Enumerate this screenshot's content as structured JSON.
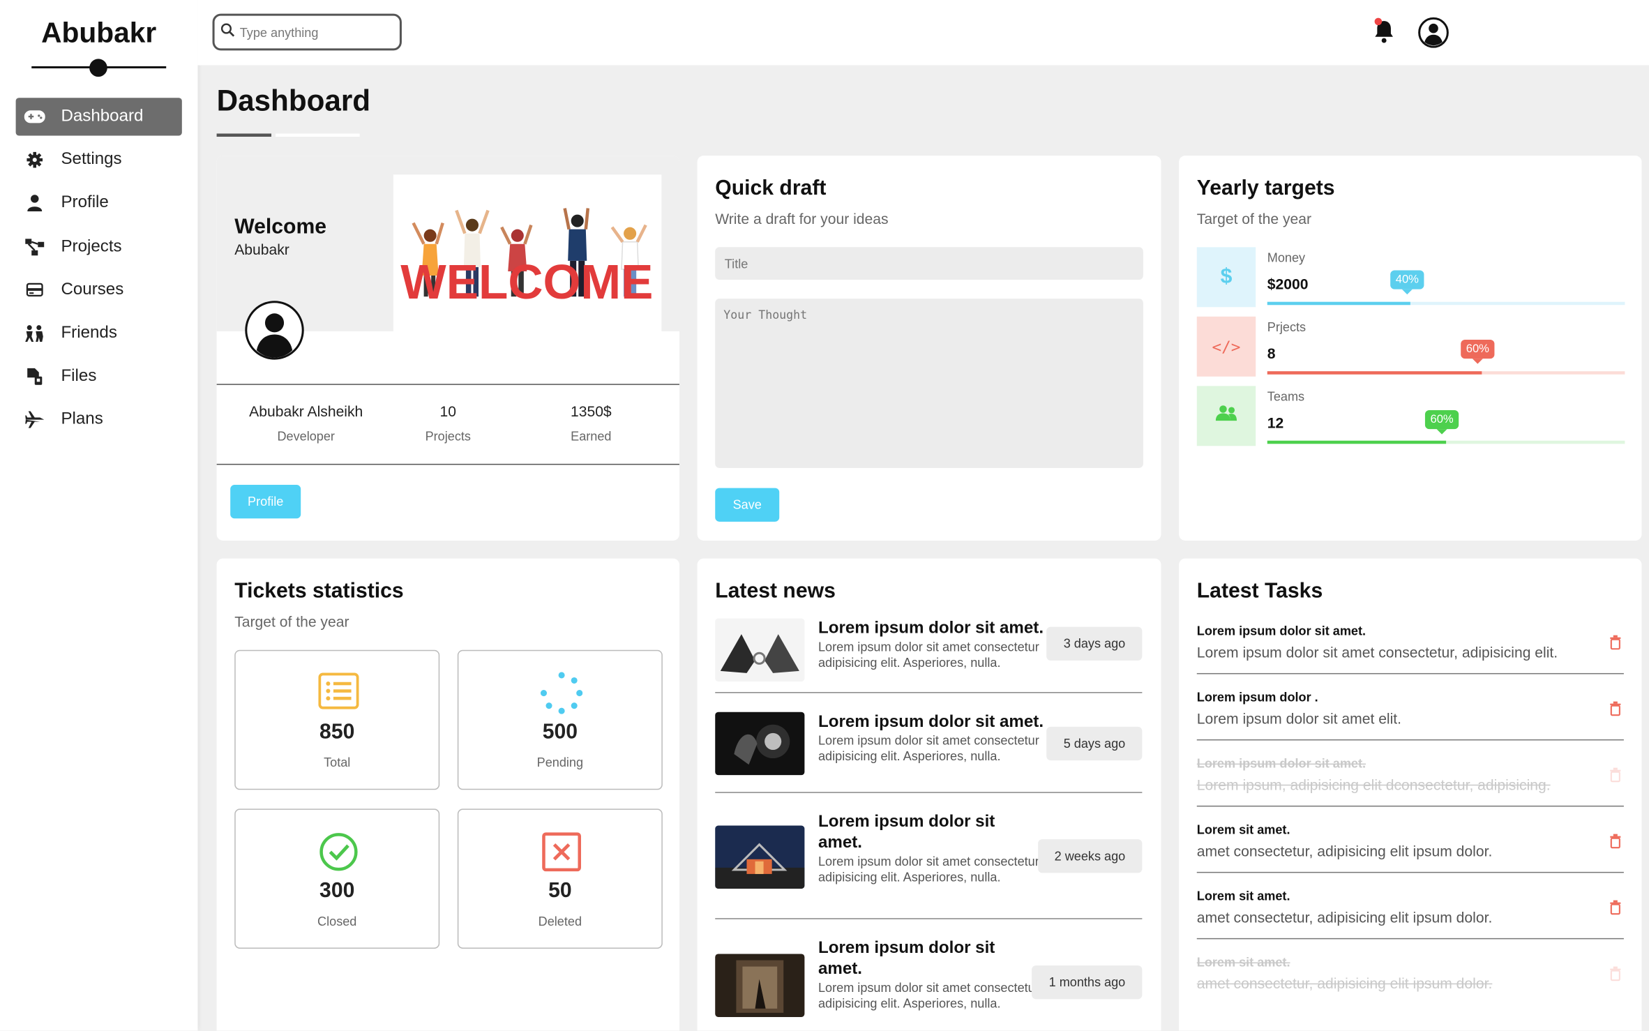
{
  "brand": "Abubakr",
  "nav": [
    {
      "label": "Dashboard",
      "icon": "gamepad-icon",
      "active": true
    },
    {
      "label": "Settings",
      "icon": "gear-icon"
    },
    {
      "label": "Profile",
      "icon": "user-icon"
    },
    {
      "label": "Projects",
      "icon": "diagram-icon"
    },
    {
      "label": "Courses",
      "icon": "card-icon"
    },
    {
      "label": "Friends",
      "icon": "people-icon"
    },
    {
      "label": "Files",
      "icon": "file-icon"
    },
    {
      "label": "Plans",
      "icon": "plane-icon"
    }
  ],
  "search": {
    "placeholder": "Type anything"
  },
  "page_title": "Dashboard",
  "welcome": {
    "title": "Welcome",
    "name": "Abubakr",
    "image_text": "WELCOME",
    "stats": [
      {
        "value": "Abubakr Alsheikh",
        "label": "Developer"
      },
      {
        "value": "10",
        "label": "Projects"
      },
      {
        "value": "1350$",
        "label": "Earned"
      }
    ],
    "button": "Profile"
  },
  "draft": {
    "title": "Quick draft",
    "subtitle": "Write a draft for your ideas",
    "title_placeholder": "Title",
    "thought_placeholder": "Your Thought",
    "button": "Save"
  },
  "targets": {
    "title": "Yearly targets",
    "subtitle": "Target of the year",
    "items": [
      {
        "label": "Money",
        "value": "$2000",
        "percent": 40,
        "percent_label": "40%",
        "icon": "dollar-icon",
        "color": "#5ccfee",
        "bg": "#dff4fc",
        "track": "#dff4fc"
      },
      {
        "label": "Prjects",
        "value": "8",
        "percent": 60,
        "percent_label": "60%",
        "icon": "code-icon",
        "color": "#ee6a5a",
        "bg": "#fcdcd7",
        "track": "#fcdcd7"
      },
      {
        "label": "Teams",
        "value": "12",
        "percent": 50,
        "percent_label": "60%",
        "icon": "users-icon",
        "color": "#4dd04d",
        "bg": "#dff6df",
        "track": "#dff6df"
      }
    ]
  },
  "tickets": {
    "title": "Tickets statistics",
    "subtitle": "Target of the year",
    "items": [
      {
        "value": "850",
        "label": "Total",
        "icon": "list-icon",
        "color": "#f5b940"
      },
      {
        "value": "500",
        "label": "Pending",
        "icon": "spinner-icon",
        "color": "#4fcbf0"
      },
      {
        "value": "300",
        "label": "Closed",
        "icon": "check-circle-icon",
        "color": "#4cc74c"
      },
      {
        "value": "50",
        "label": "Deleted",
        "icon": "x-square-icon",
        "color": "#ee6a5a"
      }
    ]
  },
  "news": {
    "title": "Latest news",
    "items": [
      {
        "heading": "Lorem ipsum dolor sit amet.",
        "text": "Lorem ipsum dolor sit amet consectetur adipisicing elit. Asperiores, nulla.",
        "time": "3 days ago"
      },
      {
        "heading": "Lorem ipsum dolor sit amet.",
        "text": "Lorem ipsum dolor sit amet consectetur adipisicing elit. Asperiores, nulla.",
        "time": "5 days ago"
      },
      {
        "heading": "Lorem ipsum dolor sit amet.",
        "text": "Lorem ipsum dolor sit amet consectetur adipisicing elit. Asperiores, nulla.",
        "time": "2 weeks ago"
      },
      {
        "heading": "Lorem ipsum dolor sit amet.",
        "text": "Lorem ipsum dolor sit amet consectetur adipisicing elit. Asperiores, nulla.",
        "time": "1 months ago"
      }
    ]
  },
  "tasks": {
    "title": "Latest Tasks",
    "items": [
      {
        "heading": "Lorem ipsum dolor sit amet.",
        "text": "Lorem ipsum dolor sit amet consectetur, adipisicing elit.",
        "done": false
      },
      {
        "heading": "Lorem ipsum dolor .",
        "text": "Lorem ipsum dolor sit amet elit.",
        "done": false
      },
      {
        "heading": "Lorem ipsum dolor sit amet.",
        "text": "Lorem ipsum, adipisicing elit dconsectetur, adipisicing.",
        "done": true
      },
      {
        "heading": "Lorem sit amet.",
        "text": "amet consectetur, adipisicing elit ipsum dolor.",
        "done": false
      },
      {
        "heading": "Lorem sit amet.",
        "text": "amet consectetur, adipisicing elit ipsum dolor.",
        "done": false
      },
      {
        "heading": "Lorem sit amet.",
        "text": "amet consectetur, adipisicing elit ipsum dolor.",
        "done": true
      }
    ]
  }
}
